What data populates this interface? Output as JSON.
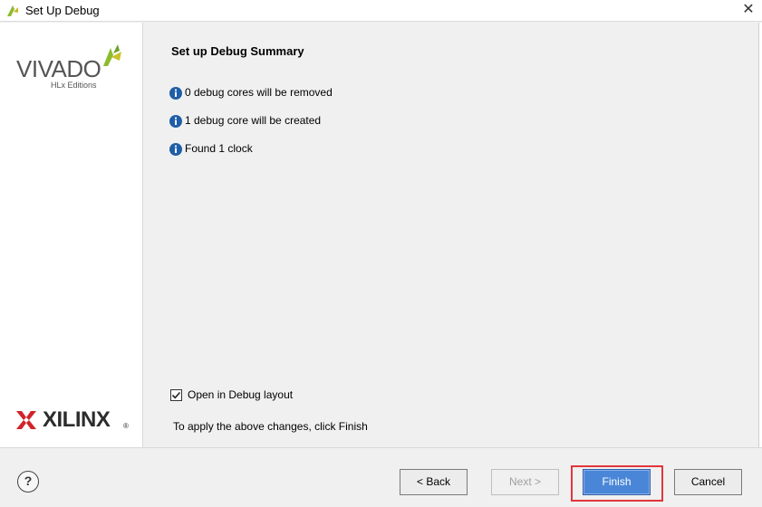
{
  "window": {
    "title": "Set Up Debug",
    "close_glyph": "✕"
  },
  "sidebar": {
    "vivado_wordmark": "VIVADO",
    "vivado_subtitle": "HLx Editions",
    "xilinx_wordmark": "XILINX",
    "xilinx_registered": "®"
  },
  "main": {
    "title": "Set up Debug Summary",
    "info_items": [
      {
        "icon": "info-icon",
        "text": "0 debug cores will be removed"
      },
      {
        "icon": "info-icon",
        "text": "1 debug core will be created"
      },
      {
        "icon": "info-icon",
        "text": "Found 1 clock"
      }
    ],
    "open_debug_layout": {
      "label": "Open in Debug layout",
      "checked": true
    },
    "apply_note": "To apply the above changes, click Finish"
  },
  "footer": {
    "help_label": "?",
    "back_label": "< Back",
    "next_label": "Next >",
    "finish_label": "Finish",
    "cancel_label": "Cancel"
  },
  "colors": {
    "accent": "#4a86d8",
    "highlight": "#e2363b",
    "info_icon": "#1f5ea8",
    "vivado_green": "#8dbb2d"
  }
}
